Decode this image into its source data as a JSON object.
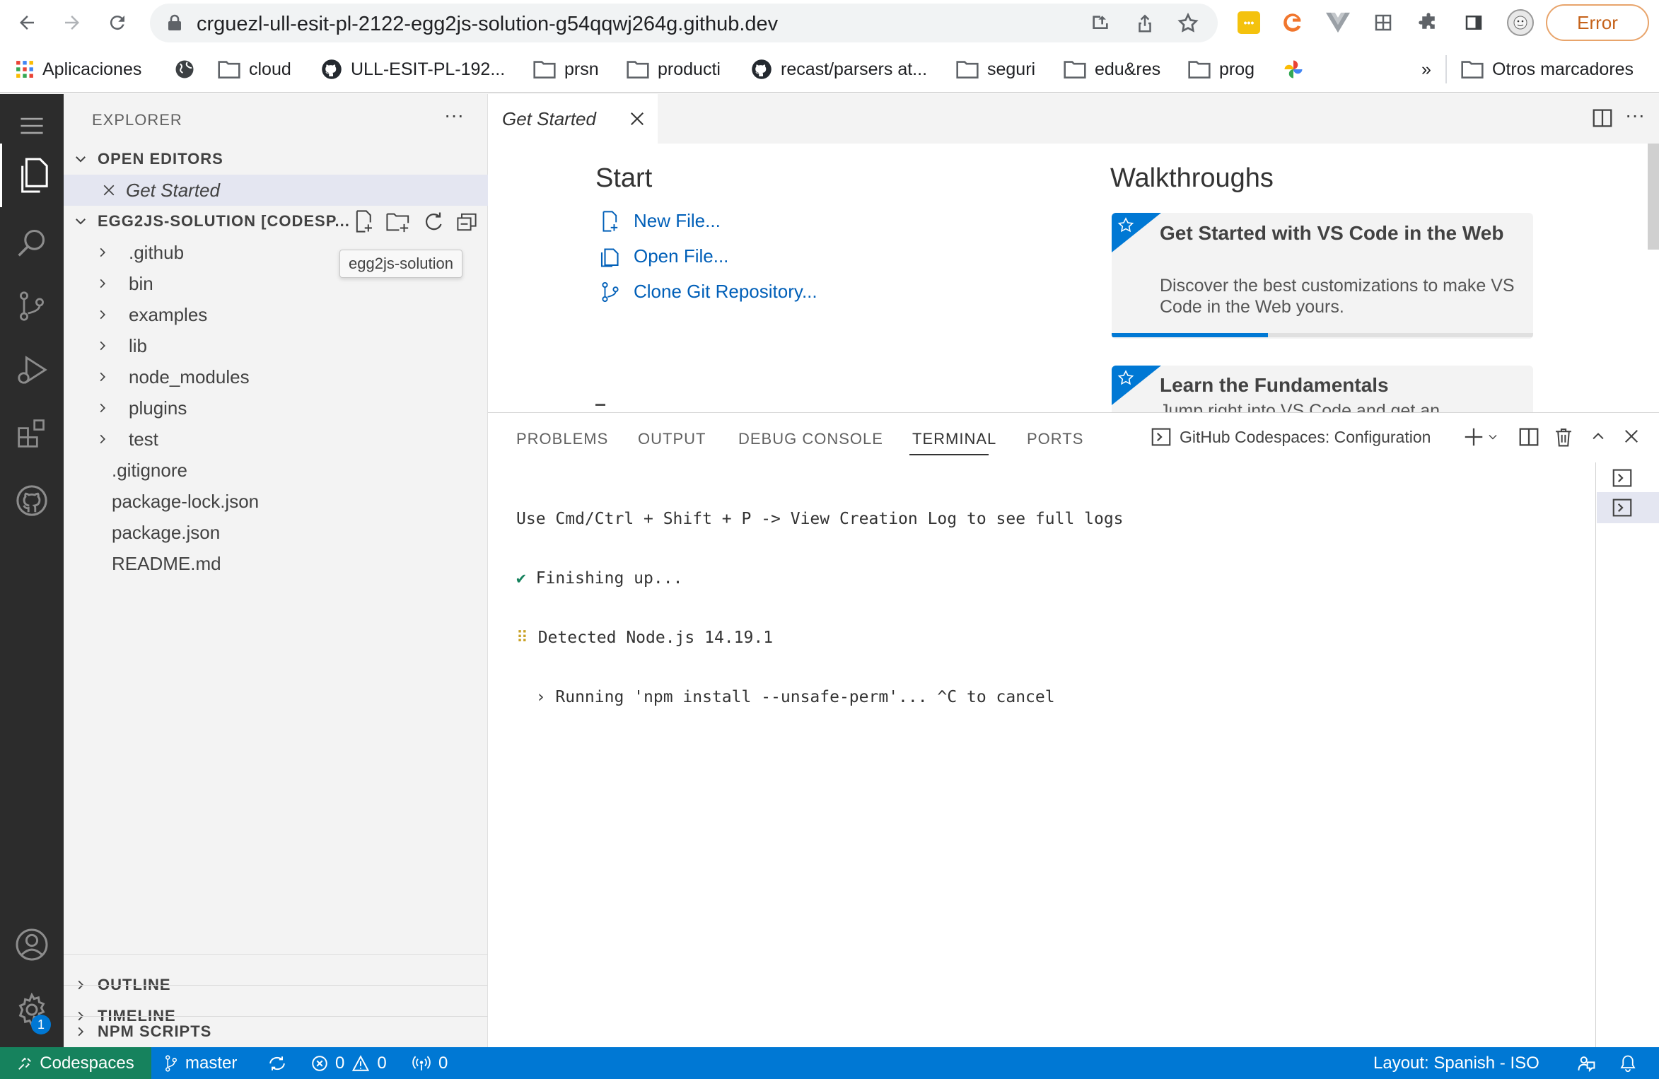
{
  "browser": {
    "url": "crguezl-ull-esit-pl-2122-egg2js-solution-g54qqwj264g.github.dev",
    "error_label": "Error"
  },
  "bookmarks": {
    "items": [
      "Aplicaciones",
      "cloud",
      "ULL-ESIT-PL-192...",
      "prsn",
      "producti",
      "recast/parsers at...",
      "seguri",
      "edu&res",
      "prog"
    ],
    "overflow": "»",
    "other": "Otros marcadores"
  },
  "sidebar": {
    "title": "EXPLORER",
    "more": "···",
    "open_editors_label": "OPEN EDITORS",
    "open_editor_item": "Get Started",
    "workspace_label": "EGG2JS-SOLUTION [CODESP...",
    "tooltip": "egg2js-solution",
    "folders": [
      ".github",
      "bin",
      "examples",
      "lib",
      "node_modules",
      "plugins",
      "test"
    ],
    "files": [
      ".gitignore",
      "package-lock.json",
      "package.json",
      "README.md"
    ],
    "bottom_sections": [
      "OUTLINE",
      "TIMELINE",
      "NPM SCRIPTS"
    ]
  },
  "editor": {
    "tab_label": "Get Started",
    "start_heading": "Start",
    "start_links": [
      "New File...",
      "Open File...",
      "Clone Git Repository..."
    ],
    "walkthroughs_heading": "Walkthroughs",
    "walkthrough1_title": "Get Started with VS Code in the Web",
    "walkthrough1_desc": "Discover the best customizations to make VS Code in the Web yours.",
    "walkthrough1_progress": 0.37,
    "walkthrough2_title": "Learn the Fundamentals",
    "walkthrough2_desc": "Jump right into VS Code and get an"
  },
  "panel": {
    "tabs": [
      "PROBLEMS",
      "OUTPUT",
      "DEBUG CONSOLE",
      "TERMINAL",
      "PORTS"
    ],
    "active_tab": "TERMINAL",
    "terminal_name": "GitHub Codespaces: Configuration",
    "terminal_lines": [
      "Use Cmd/Ctrl + Shift + P -> View Creation Log to see full logs",
      "✔ Finishing up...",
      "⠿ Detected Node.js 14.19.1",
      "  › Running 'npm install --unsafe-perm'... ^C to cancel"
    ]
  },
  "activity_bar": {
    "settings_badge": "1"
  },
  "status_bar": {
    "remote": "Codespaces",
    "branch": "master",
    "errors": "0",
    "warnings": "0",
    "ports": "0",
    "layout": "Layout: Spanish - ISO"
  },
  "colors": {
    "status_bar": "#0078d4",
    "remote_indicator": "#16825d",
    "activity_bar": "#2c2c2c",
    "link": "#005fb8"
  }
}
